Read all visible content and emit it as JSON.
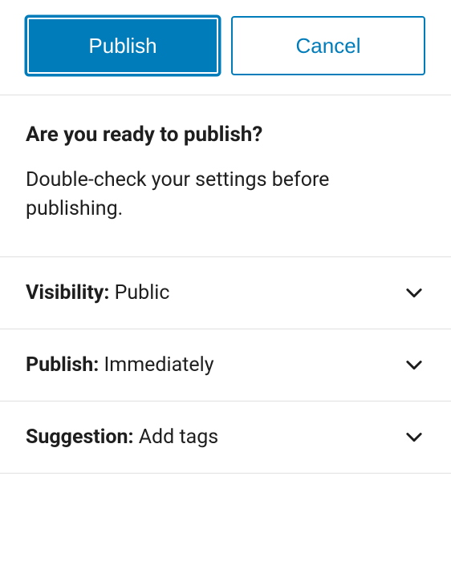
{
  "actions": {
    "publish_label": "Publish",
    "cancel_label": "Cancel"
  },
  "intro": {
    "heading": "Are you ready to publish?",
    "subtext": "Double-check your settings before publishing."
  },
  "settings": {
    "visibility": {
      "label": "Visibility:",
      "value": "Public"
    },
    "publish": {
      "label": "Publish:",
      "value": "Immediately"
    },
    "suggestion": {
      "label": "Suggestion:",
      "value": "Add tags"
    }
  }
}
